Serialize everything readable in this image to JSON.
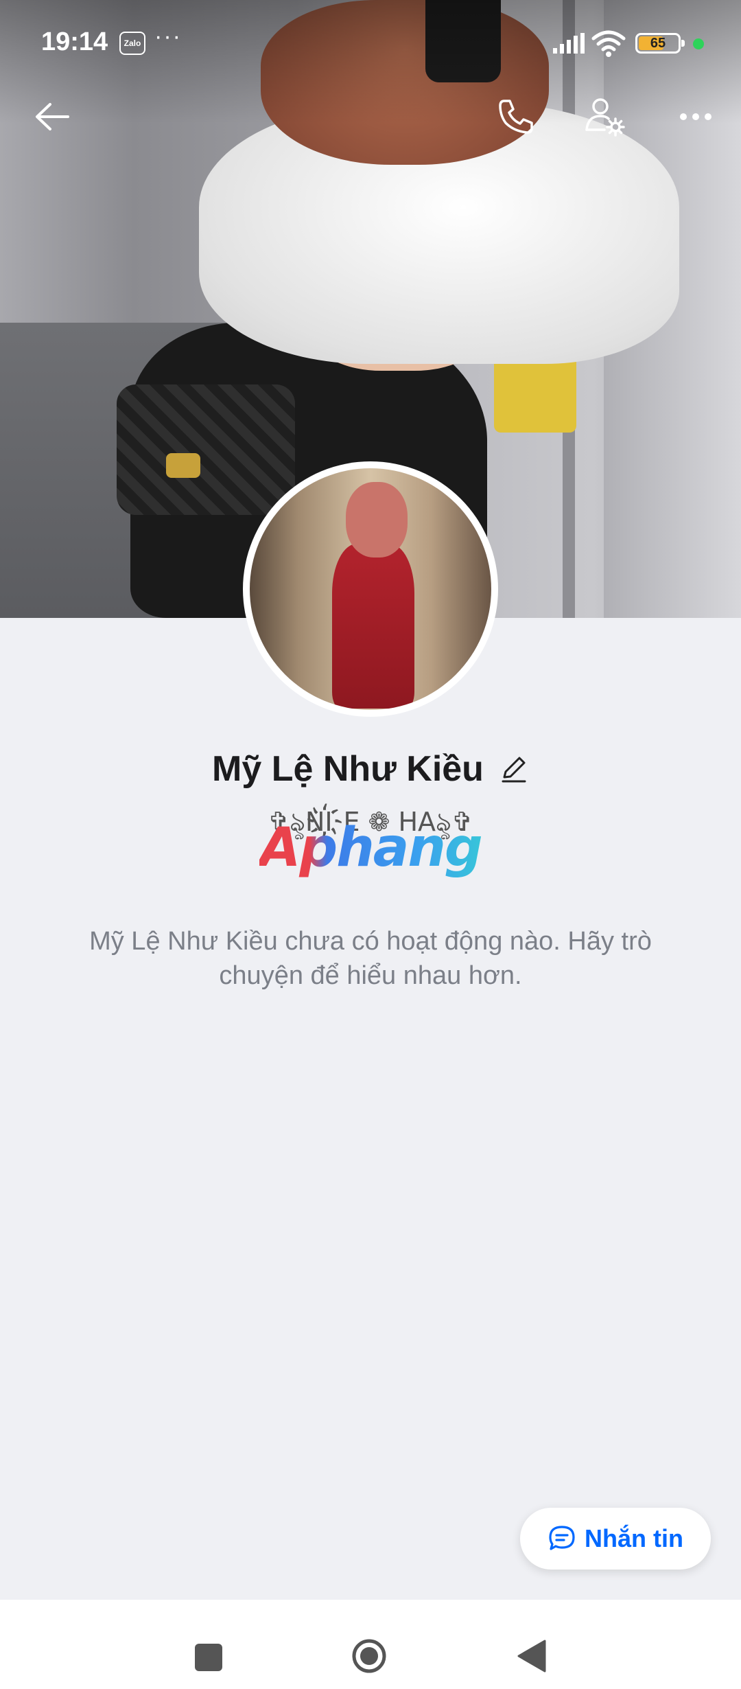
{
  "status_bar": {
    "time": "19:14",
    "zalo_badge": "Zalo",
    "more_indicator": "···",
    "battery_level": 65,
    "battery_text": "65"
  },
  "header": {
    "back_icon": "arrow-left-icon",
    "call_icon": "phone-icon",
    "user_settings_icon": "user-gear-icon",
    "more_icon": "more-dots-icon"
  },
  "profile": {
    "name": "Mỹ Lệ Như Kiều",
    "nickname": "✞ৡNI҉E ❁ HAৡ✞",
    "watermark": "Aphang",
    "empty_activity": "Mỹ Lệ Như Kiều chưa có hoạt động nào. Hãy trò chuyện để hiểu nhau hơn."
  },
  "actions": {
    "message_label": "Nhắn tin"
  },
  "colors": {
    "accent": "#0068ff",
    "background": "#eff0f4",
    "battery": "#f2b233",
    "online": "#2ed35a"
  }
}
